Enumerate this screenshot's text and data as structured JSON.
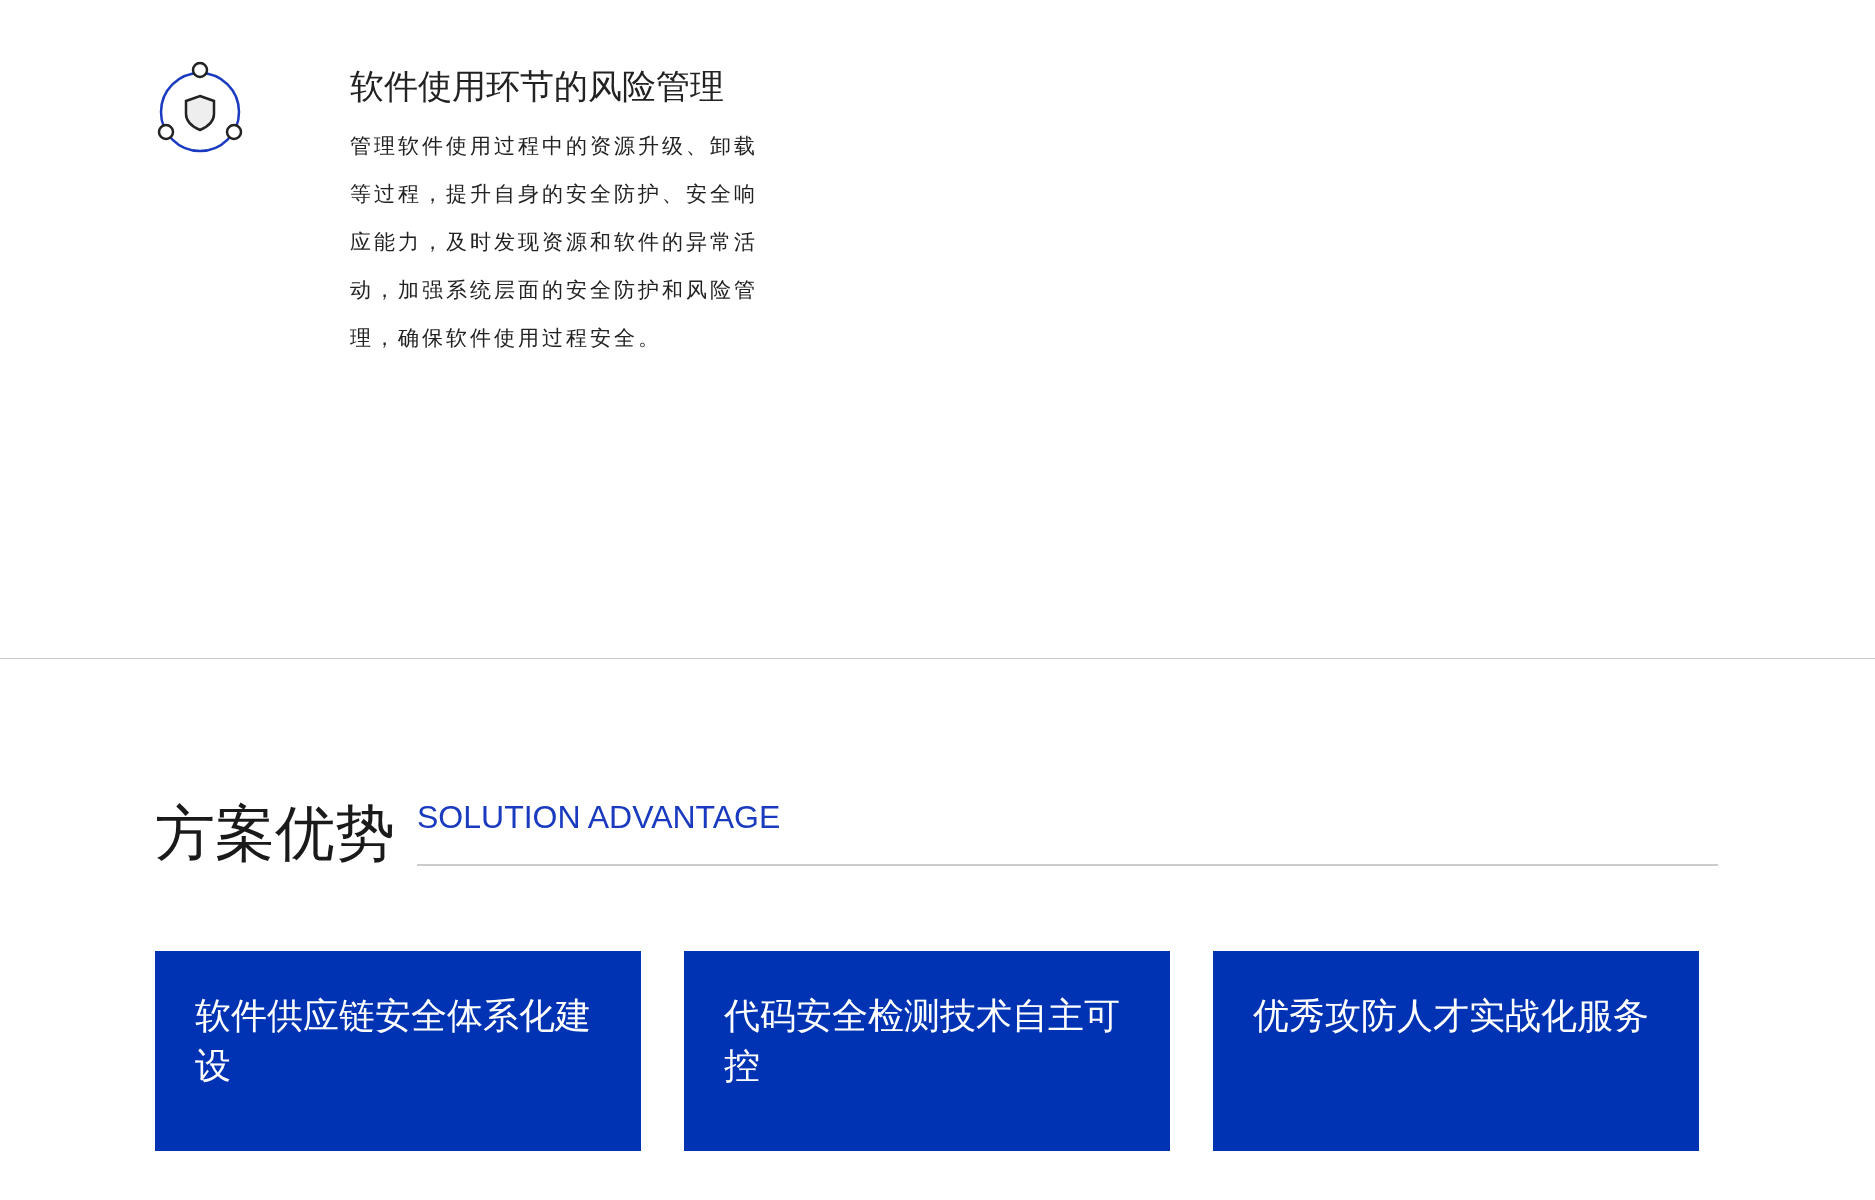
{
  "risk_item": {
    "title": "软件使用环节的风险管理",
    "description": "管理软件使用过程中的资源升级、卸载等过程，提升自身的安全防护、安全响应能力，及时发现资源和软件的异常活动，加强系统层面的安全防护和风险管理，确保软件使用过程安全。"
  },
  "advantages": {
    "title": "方案优势",
    "subtitle": "SOLUTION ADVANTAGE",
    "cards": [
      {
        "title": "软件供应链安全体系化建设"
      },
      {
        "title": "代码安全检测技术自主可控"
      },
      {
        "title": "优秀攻防人才实战化服务"
      }
    ]
  }
}
